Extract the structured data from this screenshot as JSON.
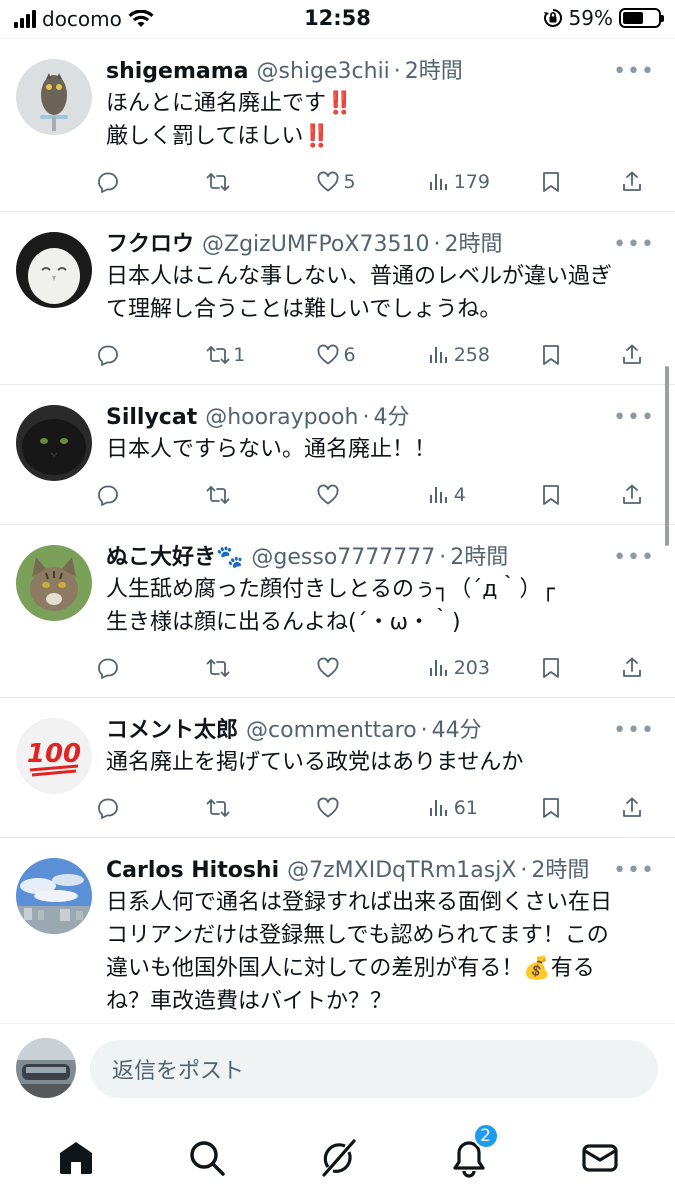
{
  "status_bar": {
    "carrier": "docomo",
    "time": "12:58",
    "battery": "59%",
    "battery_level": 0.59
  },
  "tweets": [
    {
      "name": "shigemama",
      "handle": "@shige3chii",
      "time": "2時間",
      "lines": [
        "ほんとに通名廃止です‼️",
        "厳しく罰してほしい‼️"
      ],
      "replies": "",
      "retweets": "",
      "likes": "5",
      "views": "179",
      "avatar_icon": "owl-avatar"
    },
    {
      "name": "フクロウ",
      "handle": "@ZgizUMFPoX73510",
      "time": "2時間",
      "lines": [
        "日本人はこんな事しない、普通のレベルが違い過ぎ",
        "て理解し合うことは難しいでしょうね。"
      ],
      "replies": "",
      "retweets": "1",
      "likes": "6",
      "views": "258",
      "avatar_icon": "white-owl-avatar"
    },
    {
      "name": "Sillycat",
      "handle": "@hooraypooh",
      "time": "4分",
      "lines": [
        "日本人ですらない。通名廃止！！"
      ],
      "replies": "",
      "retweets": "",
      "likes": "",
      "views": "4",
      "avatar_icon": "black-cat-avatar"
    },
    {
      "name": "ぬこ大好き🐾",
      "handle": "@gesso7777777",
      "time": "2時間",
      "lines": [
        "人生舐め腐った顔付きしとるのぅ┐（´д｀）┌",
        "生き様は顔に出るんよね(´・ω・｀)"
      ],
      "replies": "",
      "retweets": "",
      "likes": "",
      "views": "203",
      "avatar_icon": "tabby-cat-avatar"
    },
    {
      "name": "コメント太郎",
      "handle": "@commenttaro",
      "time": "44分",
      "lines": [
        "通名廃止を掲げている政党はありませんか"
      ],
      "replies": "",
      "retweets": "",
      "likes": "",
      "views": "61",
      "avatar_icon": "hundred-points-avatar"
    },
    {
      "name": "Carlos Hitoshi",
      "handle": "@7zMXIDqTRm1asjX",
      "time": "2時間",
      "lines": [
        "日系人何で通名は登録すれば出来る面倒くさい在日",
        "コリアンだけは登録無しでも認められてます！この",
        "違いも他国外国人に対しての差別が有る！💰有る",
        "ね？車改造費はバイトか？？"
      ],
      "replies": "",
      "retweets": "",
      "likes": "",
      "views": "",
      "avatar_icon": "sky-city-avatar"
    }
  ],
  "reply_bar": {
    "placeholder": "返信をポスト"
  },
  "tab_bar": {
    "tabs": [
      "home",
      "search",
      "grok",
      "notifications",
      "messages"
    ],
    "notification_badge": "2"
  },
  "colors": {
    "accent": "#1d9bf0",
    "text": "#0f1419",
    "secondary": "#536471"
  }
}
